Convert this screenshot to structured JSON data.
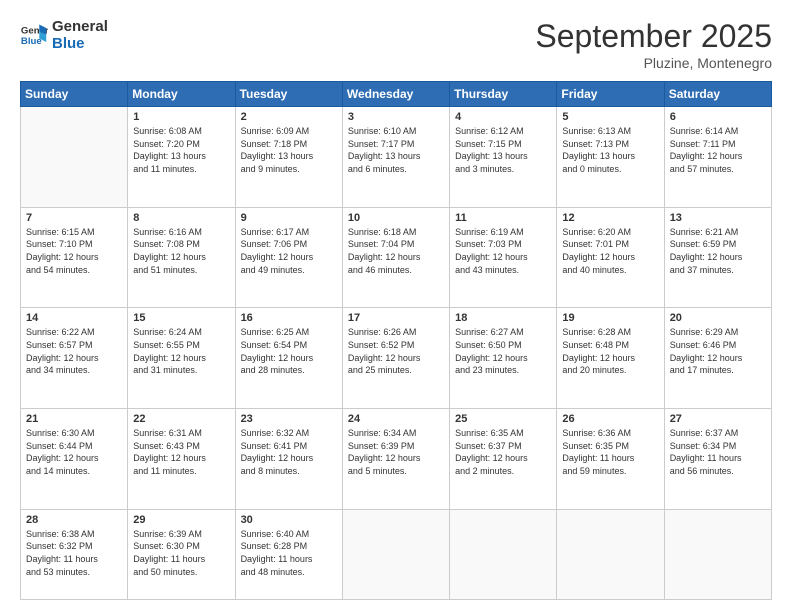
{
  "header": {
    "logo": {
      "line1": "General",
      "line2": "Blue"
    },
    "title": "September 2025",
    "location": "Pluzine, Montenegro"
  },
  "days_of_week": [
    "Sunday",
    "Monday",
    "Tuesday",
    "Wednesday",
    "Thursday",
    "Friday",
    "Saturday"
  ],
  "weeks": [
    [
      {
        "day": "",
        "info": ""
      },
      {
        "day": "1",
        "info": "Sunrise: 6:08 AM\nSunset: 7:20 PM\nDaylight: 13 hours\nand 11 minutes."
      },
      {
        "day": "2",
        "info": "Sunrise: 6:09 AM\nSunset: 7:18 PM\nDaylight: 13 hours\nand 9 minutes."
      },
      {
        "day": "3",
        "info": "Sunrise: 6:10 AM\nSunset: 7:17 PM\nDaylight: 13 hours\nand 6 minutes."
      },
      {
        "day": "4",
        "info": "Sunrise: 6:12 AM\nSunset: 7:15 PM\nDaylight: 13 hours\nand 3 minutes."
      },
      {
        "day": "5",
        "info": "Sunrise: 6:13 AM\nSunset: 7:13 PM\nDaylight: 13 hours\nand 0 minutes."
      },
      {
        "day": "6",
        "info": "Sunrise: 6:14 AM\nSunset: 7:11 PM\nDaylight: 12 hours\nand 57 minutes."
      }
    ],
    [
      {
        "day": "7",
        "info": "Sunrise: 6:15 AM\nSunset: 7:10 PM\nDaylight: 12 hours\nand 54 minutes."
      },
      {
        "day": "8",
        "info": "Sunrise: 6:16 AM\nSunset: 7:08 PM\nDaylight: 12 hours\nand 51 minutes."
      },
      {
        "day": "9",
        "info": "Sunrise: 6:17 AM\nSunset: 7:06 PM\nDaylight: 12 hours\nand 49 minutes."
      },
      {
        "day": "10",
        "info": "Sunrise: 6:18 AM\nSunset: 7:04 PM\nDaylight: 12 hours\nand 46 minutes."
      },
      {
        "day": "11",
        "info": "Sunrise: 6:19 AM\nSunset: 7:03 PM\nDaylight: 12 hours\nand 43 minutes."
      },
      {
        "day": "12",
        "info": "Sunrise: 6:20 AM\nSunset: 7:01 PM\nDaylight: 12 hours\nand 40 minutes."
      },
      {
        "day": "13",
        "info": "Sunrise: 6:21 AM\nSunset: 6:59 PM\nDaylight: 12 hours\nand 37 minutes."
      }
    ],
    [
      {
        "day": "14",
        "info": "Sunrise: 6:22 AM\nSunset: 6:57 PM\nDaylight: 12 hours\nand 34 minutes."
      },
      {
        "day": "15",
        "info": "Sunrise: 6:24 AM\nSunset: 6:55 PM\nDaylight: 12 hours\nand 31 minutes."
      },
      {
        "day": "16",
        "info": "Sunrise: 6:25 AM\nSunset: 6:54 PM\nDaylight: 12 hours\nand 28 minutes."
      },
      {
        "day": "17",
        "info": "Sunrise: 6:26 AM\nSunset: 6:52 PM\nDaylight: 12 hours\nand 25 minutes."
      },
      {
        "day": "18",
        "info": "Sunrise: 6:27 AM\nSunset: 6:50 PM\nDaylight: 12 hours\nand 23 minutes."
      },
      {
        "day": "19",
        "info": "Sunrise: 6:28 AM\nSunset: 6:48 PM\nDaylight: 12 hours\nand 20 minutes."
      },
      {
        "day": "20",
        "info": "Sunrise: 6:29 AM\nSunset: 6:46 PM\nDaylight: 12 hours\nand 17 minutes."
      }
    ],
    [
      {
        "day": "21",
        "info": "Sunrise: 6:30 AM\nSunset: 6:44 PM\nDaylight: 12 hours\nand 14 minutes."
      },
      {
        "day": "22",
        "info": "Sunrise: 6:31 AM\nSunset: 6:43 PM\nDaylight: 12 hours\nand 11 minutes."
      },
      {
        "day": "23",
        "info": "Sunrise: 6:32 AM\nSunset: 6:41 PM\nDaylight: 12 hours\nand 8 minutes."
      },
      {
        "day": "24",
        "info": "Sunrise: 6:34 AM\nSunset: 6:39 PM\nDaylight: 12 hours\nand 5 minutes."
      },
      {
        "day": "25",
        "info": "Sunrise: 6:35 AM\nSunset: 6:37 PM\nDaylight: 12 hours\nand 2 minutes."
      },
      {
        "day": "26",
        "info": "Sunrise: 6:36 AM\nSunset: 6:35 PM\nDaylight: 11 hours\nand 59 minutes."
      },
      {
        "day": "27",
        "info": "Sunrise: 6:37 AM\nSunset: 6:34 PM\nDaylight: 11 hours\nand 56 minutes."
      }
    ],
    [
      {
        "day": "28",
        "info": "Sunrise: 6:38 AM\nSunset: 6:32 PM\nDaylight: 11 hours\nand 53 minutes."
      },
      {
        "day": "29",
        "info": "Sunrise: 6:39 AM\nSunset: 6:30 PM\nDaylight: 11 hours\nand 50 minutes."
      },
      {
        "day": "30",
        "info": "Sunrise: 6:40 AM\nSunset: 6:28 PM\nDaylight: 11 hours\nand 48 minutes."
      },
      {
        "day": "",
        "info": ""
      },
      {
        "day": "",
        "info": ""
      },
      {
        "day": "",
        "info": ""
      },
      {
        "day": "",
        "info": ""
      }
    ]
  ]
}
